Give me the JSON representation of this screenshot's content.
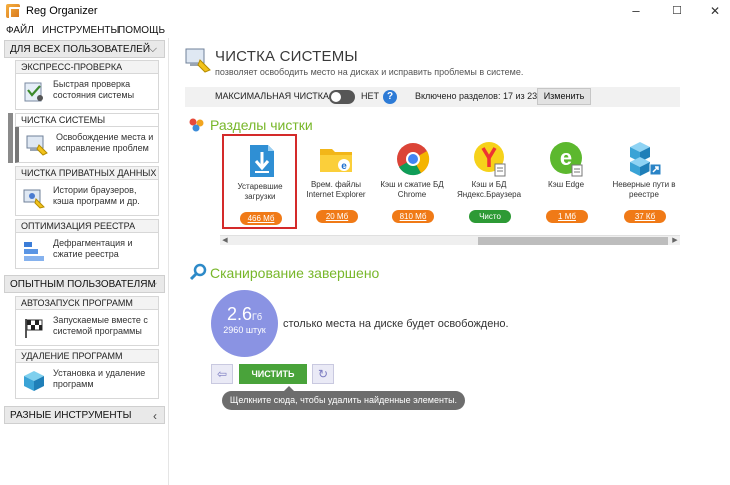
{
  "window": {
    "title": "Reg Organizer",
    "minimize": "–",
    "maximize": "☐",
    "close": "✕"
  },
  "menu": [
    "ФАЙЛ",
    "ИНСТРУМЕНТЫ",
    "ПОМОЩЬ"
  ],
  "sidebar": {
    "all_users": "ДЛЯ ВСЕХ ПОЛЬЗОВАТЕЛЕЙ",
    "groups_all": [
      {
        "title": "ЭКСПРЕСС-ПРОВЕРКА",
        "text": "Быстрая проверка состояния системы",
        "icon": "stethoscope-icon"
      },
      {
        "title": "ЧИСТКА СИСТЕМЫ",
        "text": "Освобождение места и исправление проблем",
        "icon": "broom-icon"
      },
      {
        "title": "ЧИСТКА ПРИВАТНЫХ ДАННЫХ",
        "text": "Истории браузеров, кэша программ и др.",
        "icon": "privacy-icon"
      },
      {
        "title": "ОПТИМИЗАЦИЯ РЕЕСТРА",
        "text": "Дефрагментация и сжатие реестра",
        "icon": "registry-icon"
      }
    ],
    "experienced_users": "ОПЫТНЫМ ПОЛЬЗОВАТЕЛЯМ",
    "groups_exp": [
      {
        "title": "АВТОЗАПУСК ПРОГРАММ",
        "text": "Запускаемые вместе с системой программы",
        "icon": "flag-icon"
      },
      {
        "title": "УДАЛЕНИЕ ПРОГРАММ",
        "text": "Установка и удаление программ",
        "icon": "box-icon"
      }
    ],
    "misc_tools": "РАЗНЫЕ ИНСТРУМЕНТЫ"
  },
  "header": {
    "title": "ЧИСТКА СИСТЕМЫ",
    "subtitle": "позволяет освободить место на дисках и исправить проблемы в системе."
  },
  "options": {
    "max_clean_label": "МАКСИМАЛЬНАЯ ЧИСТКА",
    "toggle_state": "НЕТ",
    "help": "?",
    "sections_enabled": "Включено разделов: 17 из 23",
    "change_button": "Изменить"
  },
  "sections": {
    "title": "Разделы чистки",
    "tiles": [
      {
        "label": "Устаревшие загрузки",
        "badge": "466 Мб",
        "status": "size",
        "icon": "download-doc-icon",
        "selected": true
      },
      {
        "label": "Врем. файлы Internet Explorer",
        "badge": "20 Мб",
        "status": "size",
        "icon": "folder-ie-icon",
        "selected": false
      },
      {
        "label": "Кэш и сжатие БД Chrome",
        "badge": "810 Мб",
        "status": "size",
        "icon": "chrome-icon",
        "selected": false
      },
      {
        "label": "Кэш и БД Яндекс.Браузера",
        "badge": "Чисто",
        "status": "clean",
        "icon": "yandex-icon",
        "selected": false
      },
      {
        "label": "Кэш Edge",
        "badge": "1 Мб",
        "status": "size",
        "icon": "edge-icon",
        "selected": false
      },
      {
        "label": "Неверные пути в реестре",
        "badge": "37 Кб",
        "status": "size",
        "icon": "registry-cubes-icon",
        "selected": false
      }
    ]
  },
  "scan": {
    "title": "Сканирование завершено",
    "size_value": "2.6",
    "size_unit": "Гб",
    "count": "2960 штук",
    "free_text": "столько места на диске будет освобождено.",
    "clean_button": "ЧИСТИТЬ",
    "tooltip": "Щелкните сюда, чтобы удалить найденные элементы."
  },
  "colors": {
    "accent_green": "#78b72a",
    "badge_orange": "#f07a17",
    "badge_green": "#2d9a35",
    "selection_red": "#d42a2a",
    "bubble": "#8a93e3"
  }
}
